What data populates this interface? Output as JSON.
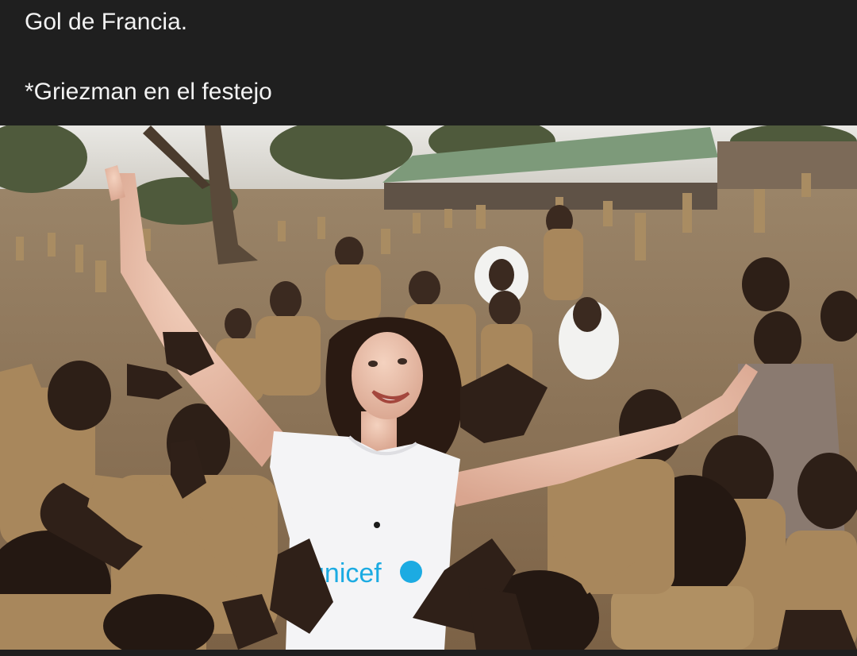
{
  "post": {
    "caption_line_1": "Gol de Francia.",
    "caption_line_2": "*Griezman en el festejo"
  },
  "photo": {
    "shirt_logo_text": "unicef",
    "colors": {
      "background": "#1f1f1f",
      "caption_text": "#f2f2f2",
      "ground": "#8a7558",
      "uniform": "#a8875c",
      "unicef_blue": "#1cabe2"
    }
  }
}
